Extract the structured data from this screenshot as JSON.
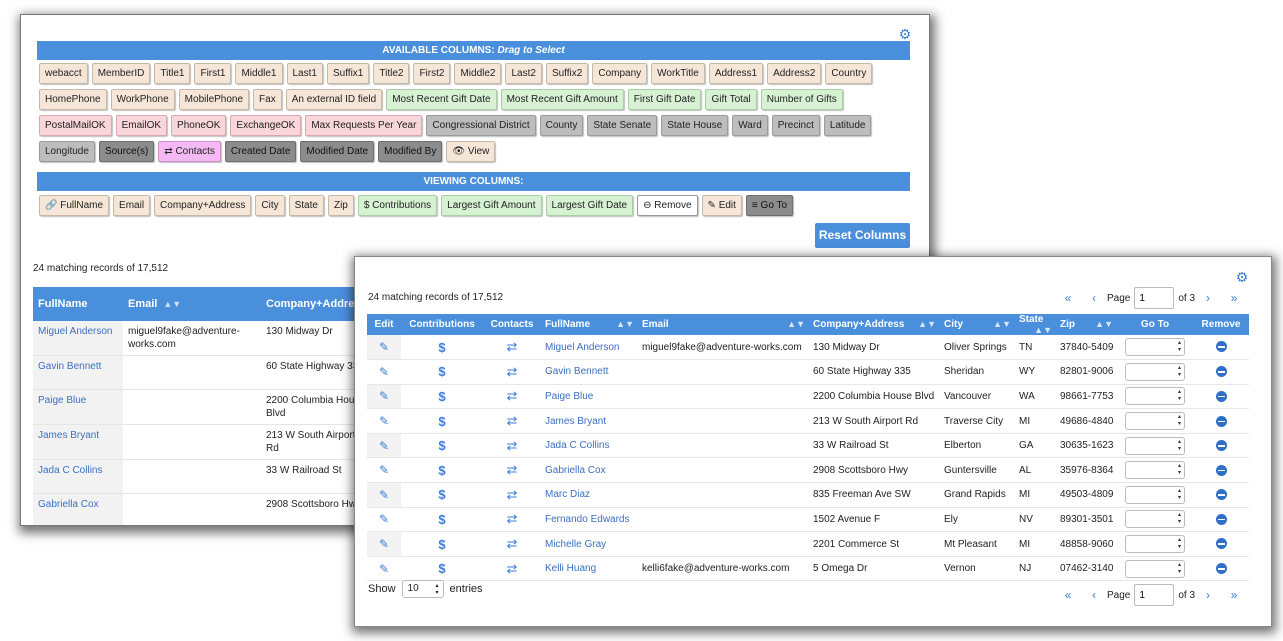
{
  "available_columns": {
    "header_prefix": "AVAILABLE COLUMNS:",
    "header_hint": "Drag to Select",
    "chips": [
      {
        "label": "webacct",
        "color": "peach"
      },
      {
        "label": "MemberID",
        "color": "peach"
      },
      {
        "label": "Title1",
        "color": "peach"
      },
      {
        "label": "First1",
        "color": "peach"
      },
      {
        "label": "Middle1",
        "color": "peach"
      },
      {
        "label": "Last1",
        "color": "peach"
      },
      {
        "label": "Suffix1",
        "color": "peach"
      },
      {
        "label": "Title2",
        "color": "peach"
      },
      {
        "label": "First2",
        "color": "peach"
      },
      {
        "label": "Middle2",
        "color": "peach"
      },
      {
        "label": "Last2",
        "color": "peach"
      },
      {
        "label": "Suffix2",
        "color": "peach"
      },
      {
        "label": "Company",
        "color": "peach"
      },
      {
        "label": "WorkTitle",
        "color": "peach"
      },
      {
        "label": "Address1",
        "color": "peach"
      },
      {
        "label": "Address2",
        "color": "peach"
      },
      {
        "label": "Country",
        "color": "peach"
      },
      {
        "label": "HomePhone",
        "color": "peach"
      },
      {
        "label": "WorkPhone",
        "color": "peach"
      },
      {
        "label": "MobilePhone",
        "color": "peach"
      },
      {
        "label": "Fax",
        "color": "peach"
      },
      {
        "label": "An external ID field",
        "color": "peach"
      },
      {
        "label": "Most Recent Gift Date",
        "color": "green"
      },
      {
        "label": "Most Recent Gift Amount",
        "color": "green"
      },
      {
        "label": "First Gift Date",
        "color": "green"
      },
      {
        "label": "Gift Total",
        "color": "green"
      },
      {
        "label": "Number of Gifts",
        "color": "green"
      },
      {
        "label": "PostalMailOK",
        "color": "pink"
      },
      {
        "label": "EmailOK",
        "color": "pink"
      },
      {
        "label": "PhoneOK",
        "color": "pink"
      },
      {
        "label": "ExchangeOK",
        "color": "pink"
      },
      {
        "label": "Max Requests Per Year",
        "color": "pink"
      },
      {
        "label": "Congressional District",
        "color": "gray"
      },
      {
        "label": "County",
        "color": "gray"
      },
      {
        "label": "State Senate",
        "color": "gray"
      },
      {
        "label": "State House",
        "color": "gray"
      },
      {
        "label": "Ward",
        "color": "gray"
      },
      {
        "label": "Precinct",
        "color": "gray"
      },
      {
        "label": "Latitude",
        "color": "gray"
      },
      {
        "label": "Longitude",
        "color": "gray"
      },
      {
        "label": "Source(s)",
        "color": "dgray"
      },
      {
        "label": "⇄ Contacts",
        "color": "magenta"
      },
      {
        "label": "Created Date",
        "color": "dgray"
      },
      {
        "label": "Modified Date",
        "color": "dgray"
      },
      {
        "label": "Modified By",
        "color": "dgray"
      },
      {
        "label": "👁 View",
        "color": "peach"
      }
    ]
  },
  "viewing_columns": {
    "header": "VIEWING COLUMNS:",
    "chips": [
      {
        "label": "🔗 FullName",
        "color": "peach"
      },
      {
        "label": "Email",
        "color": "peach"
      },
      {
        "label": "Company+Address",
        "color": "peach"
      },
      {
        "label": "City",
        "color": "peach"
      },
      {
        "label": "State",
        "color": "peach"
      },
      {
        "label": "Zip",
        "color": "peach"
      },
      {
        "label": "$ Contributions",
        "color": "green"
      },
      {
        "label": "Largest Gift Amount",
        "color": "green"
      },
      {
        "label": "Largest Gift Date",
        "color": "green"
      },
      {
        "label": "⊖ Remove",
        "color": "white"
      },
      {
        "label": "✎ Edit",
        "color": "peach"
      },
      {
        "label": "≡ Go To",
        "color": "dgray"
      }
    ]
  },
  "reset_button": "Reset Columns",
  "matching_text": "24 matching records of 17,512",
  "back_table": {
    "headers": [
      "FullName",
      "Email",
      "Company+Address"
    ],
    "rows": [
      {
        "name": "Miguel  Anderson",
        "email": "miguel9fake@adventure-works.com",
        "address": "130 Midway Dr"
      },
      {
        "name": "Gavin  Bennett",
        "email": "",
        "address": "60 State Highway 335"
      },
      {
        "name": "Paige  Blue",
        "email": "",
        "address": "2200 Columbia House Blvd"
      },
      {
        "name": "James  Bryant",
        "email": "",
        "address": "213 W South Airport Rd"
      },
      {
        "name": "Jada C Collins",
        "email": "",
        "address": "33 W Railroad St"
      },
      {
        "name": "Gabriella  Cox",
        "email": "",
        "address": "2908 Scottsboro Hwy"
      }
    ]
  },
  "front_table": {
    "headers": {
      "edit": "Edit",
      "contributions": "Contributions",
      "contacts": "Contacts",
      "fullname": "FullName",
      "email": "Email",
      "address": "Company+Address",
      "city": "City",
      "state": "State",
      "zip": "Zip",
      "goto": "Go To",
      "remove": "Remove"
    },
    "rows": [
      {
        "name": "Miguel  Anderson",
        "email": "miguel9fake@adventure-works.com",
        "address": "130 Midway Dr",
        "city": "Oliver Springs",
        "state": "TN",
        "zip": "37840-5409"
      },
      {
        "name": "Gavin  Bennett",
        "email": "",
        "address": "60 State Highway 335",
        "city": "Sheridan",
        "state": "WY",
        "zip": "82801-9006"
      },
      {
        "name": "Paige  Blue",
        "email": "",
        "address": "2200 Columbia House Blvd",
        "city": "Vancouver",
        "state": "WA",
        "zip": "98661-7753"
      },
      {
        "name": "James  Bryant",
        "email": "",
        "address": "213 W South Airport Rd",
        "city": "Traverse City",
        "state": "MI",
        "zip": "49686-4840"
      },
      {
        "name": "Jada C Collins",
        "email": "",
        "address": "33 W Railroad St",
        "city": "Elberton",
        "state": "GA",
        "zip": "30635-1623"
      },
      {
        "name": "Gabriella  Cox",
        "email": "",
        "address": "2908 Scottsboro Hwy",
        "city": "Guntersville",
        "state": "AL",
        "zip": "35976-8364"
      },
      {
        "name": "Marc  Diaz",
        "email": "",
        "address": "835 Freeman Ave SW",
        "city": "Grand Rapids",
        "state": "MI",
        "zip": "49503-4809"
      },
      {
        "name": "Fernando  Edwards",
        "email": "",
        "address": "1502 Avenue F",
        "city": "Ely",
        "state": "NV",
        "zip": "89301-3501"
      },
      {
        "name": "Michelle  Gray",
        "email": "",
        "address": "2201 Commerce St",
        "city": "Mt Pleasant",
        "state": "MI",
        "zip": "48858-9060"
      },
      {
        "name": "Kelli  Huang",
        "email": "kelli6fake@adventure-works.com",
        "address": "5 Omega Dr",
        "city": "Vernon",
        "state": "NJ",
        "zip": "07462-3140"
      }
    ]
  },
  "pager": {
    "page_label": "Page",
    "page_value": "1",
    "of_label": "of 3"
  },
  "show_entries": {
    "show_label": "Show",
    "value": "10",
    "entries_label": "entries"
  },
  "icons": {
    "gear": "gear-icon",
    "edit": "edit-icon",
    "dollar": "dollar-icon",
    "swap": "swap-icon",
    "remove": "remove-icon"
  },
  "colors": {
    "accent": "#4a8fdc",
    "link": "#3b6fc0"
  }
}
